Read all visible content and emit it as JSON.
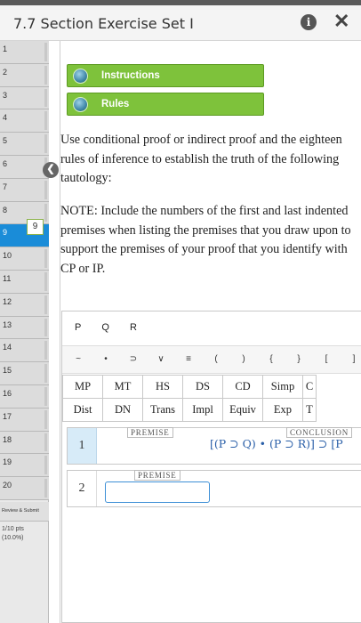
{
  "window": {
    "title": "7.7 Section Exercise Set I"
  },
  "sidebar": {
    "items": [
      "1",
      "2",
      "3",
      "4",
      "5",
      "6",
      "7",
      "8",
      "9",
      "10",
      "11",
      "12",
      "13",
      "14",
      "15",
      "16",
      "17",
      "18",
      "19",
      "20"
    ],
    "active_index": 8,
    "review_label": "Review & Submit",
    "points": "1/10 pts",
    "percent": "(10.0%)",
    "tooltip": "9"
  },
  "buttons": {
    "instructions": "Instructions",
    "rules": "Rules"
  },
  "content": {
    "paragraph1": "Use conditional proof or indirect proof and the eighteen rules of inference to establish the truth of the following tautology:",
    "paragraph2": "NOTE: Include the numbers of the first and last indented premises when listing the premises that you draw upon to support the premises of your proof that you identify with CP or IP."
  },
  "editor": {
    "variables": [
      "P",
      "Q",
      "R"
    ],
    "symbols": [
      "~",
      "•",
      "⊃",
      "∨",
      "≡",
      "(",
      ")",
      "{",
      "}",
      "[",
      "]"
    ],
    "rules_row1": [
      "MP",
      "MT",
      "HS",
      "DS",
      "CD",
      "Simp",
      "C"
    ],
    "rules_row2": [
      "Dist",
      "DN",
      "Trans",
      "Impl",
      "Equiv",
      "Exp",
      "T"
    ],
    "line1": {
      "number": "1",
      "premise_tag": "PREMISE",
      "conclusion_tag": "CONCLUSION",
      "formula": "[(P ⊃ Q) • (P ⊃ R)] ⊃ [P"
    },
    "line2": {
      "number": "2",
      "premise_tag": "PREMISE"
    }
  },
  "icons": {
    "info": "info-icon",
    "close": "close-icon",
    "collapse": "chevron-left-icon",
    "globe": "globe-icon"
  },
  "colors": {
    "accent_green": "#7ec23b",
    "active_blue": "#1a8cd8",
    "formula_blue": "#2a5fa8"
  }
}
